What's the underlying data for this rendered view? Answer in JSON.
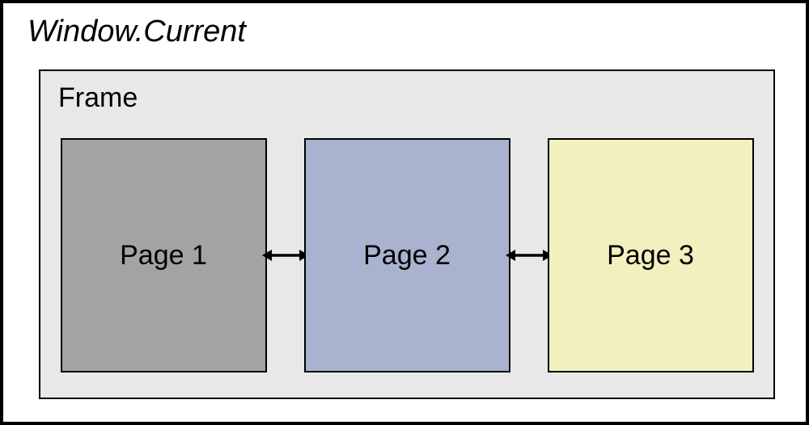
{
  "window": {
    "title": "Window.Current"
  },
  "frame": {
    "title": "Frame",
    "pages": [
      {
        "label": "Page 1",
        "bgColor": "#a3a3a3"
      },
      {
        "label": "Page 2",
        "bgColor": "#a9b3d0"
      },
      {
        "label": "Page 3",
        "bgColor": "#f2f0bf"
      }
    ],
    "arrows": [
      {
        "type": "bidirectional"
      },
      {
        "type": "bidirectional"
      }
    ]
  }
}
